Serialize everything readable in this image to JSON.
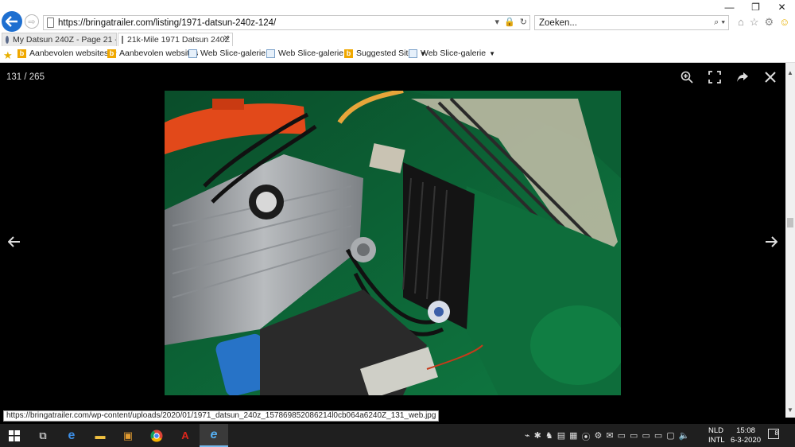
{
  "browser": {
    "url": "https://bringatrailer.com/listing/1971-datsun-240z-124/",
    "search_placeholder": "Zoeken...",
    "tabs": [
      {
        "label": "My Datsun 240Z - Page 21 - Int...",
        "active": false
      },
      {
        "label": "21k-Mile 1971 Datsun 240Z ...",
        "active": true
      }
    ],
    "favorites": [
      {
        "label": "Aanbevolen websites",
        "icon": "bing-icon",
        "dropdown": true
      },
      {
        "label": "Aanbevolen websites",
        "icon": "bing-icon",
        "dropdown": false
      },
      {
        "label": "Web Slice-galerie",
        "icon": "web-slice-icon",
        "dropdown": true
      },
      {
        "label": "Web Slice-galerie",
        "icon": "web-slice-icon",
        "dropdown": true
      },
      {
        "label": "Suggested Sites",
        "icon": "bing-icon",
        "dropdown": true
      },
      {
        "label": "Web Slice-galerie",
        "icon": "web-slice-icon",
        "dropdown": true
      }
    ],
    "status_url": "https://bringatrailer.com/wp-content/uploads/2020/01/1971_datsun_240z_157869852086214l0cb064a6240Z_131_web.jpg"
  },
  "viewer": {
    "counter": "131 / 265",
    "photo_alt": "engine bay photo"
  },
  "taskbar": {
    "language": [
      "NLD",
      "INTL"
    ],
    "time": "15:08",
    "date": "6-3-2020",
    "notifications": "8"
  },
  "colors": {
    "accent": "#1e6fd0",
    "paint_green": "#0d6b3a",
    "taskbar": "#1f1f1f"
  }
}
